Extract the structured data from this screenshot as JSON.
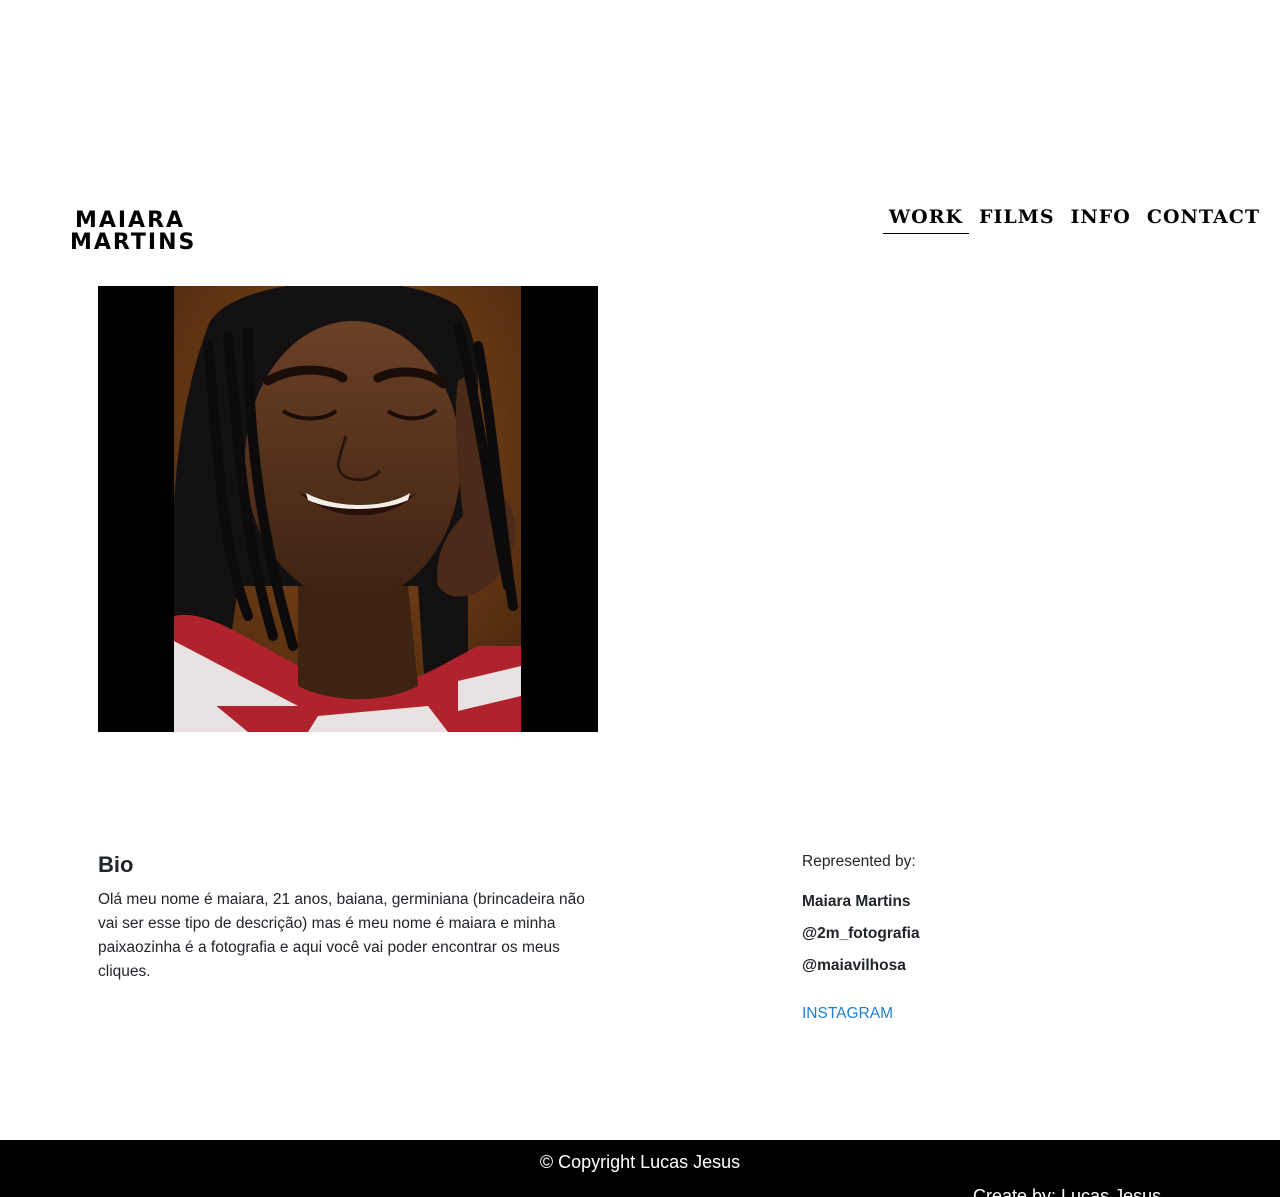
{
  "header": {
    "logo_line1": "MAIARA",
    "logo_line2": "MARTINS",
    "nav": [
      {
        "label": "WORK",
        "active": true
      },
      {
        "label": "FILMS",
        "active": false
      },
      {
        "label": "INFO",
        "active": false
      },
      {
        "label": "CONTACT",
        "active": false
      }
    ]
  },
  "photo": {
    "subject": "portrait of smiling woman with braids",
    "colors": {
      "frame": "#000000",
      "backdrop": "#7a4418",
      "skin": "#5b341e",
      "hair": "#111111",
      "shirt_red": "#b0222c",
      "shirt_white": "#e8e2e2"
    }
  },
  "bio": {
    "title": "Bio",
    "text": "Olá meu nome é maiara, 21 anos, baiana, germiniana (brincadeira não vai ser esse tipo de descrição) mas é meu nome é maiara e minha paixaozinha é a fotografia e aqui você vai poder encontrar os meus cliques."
  },
  "representation": {
    "label": "Represented by:",
    "names": [
      "Maiara Martins",
      "@2m_fotografia",
      "@maiavilhosa"
    ],
    "link_label": "INSTAGRAM",
    "link_color": "#1e7fd6"
  },
  "footer": {
    "copyright": "© Copyright Lucas Jesus",
    "created_by": "Create by: Lucas Jesus",
    "background": "#000000"
  }
}
